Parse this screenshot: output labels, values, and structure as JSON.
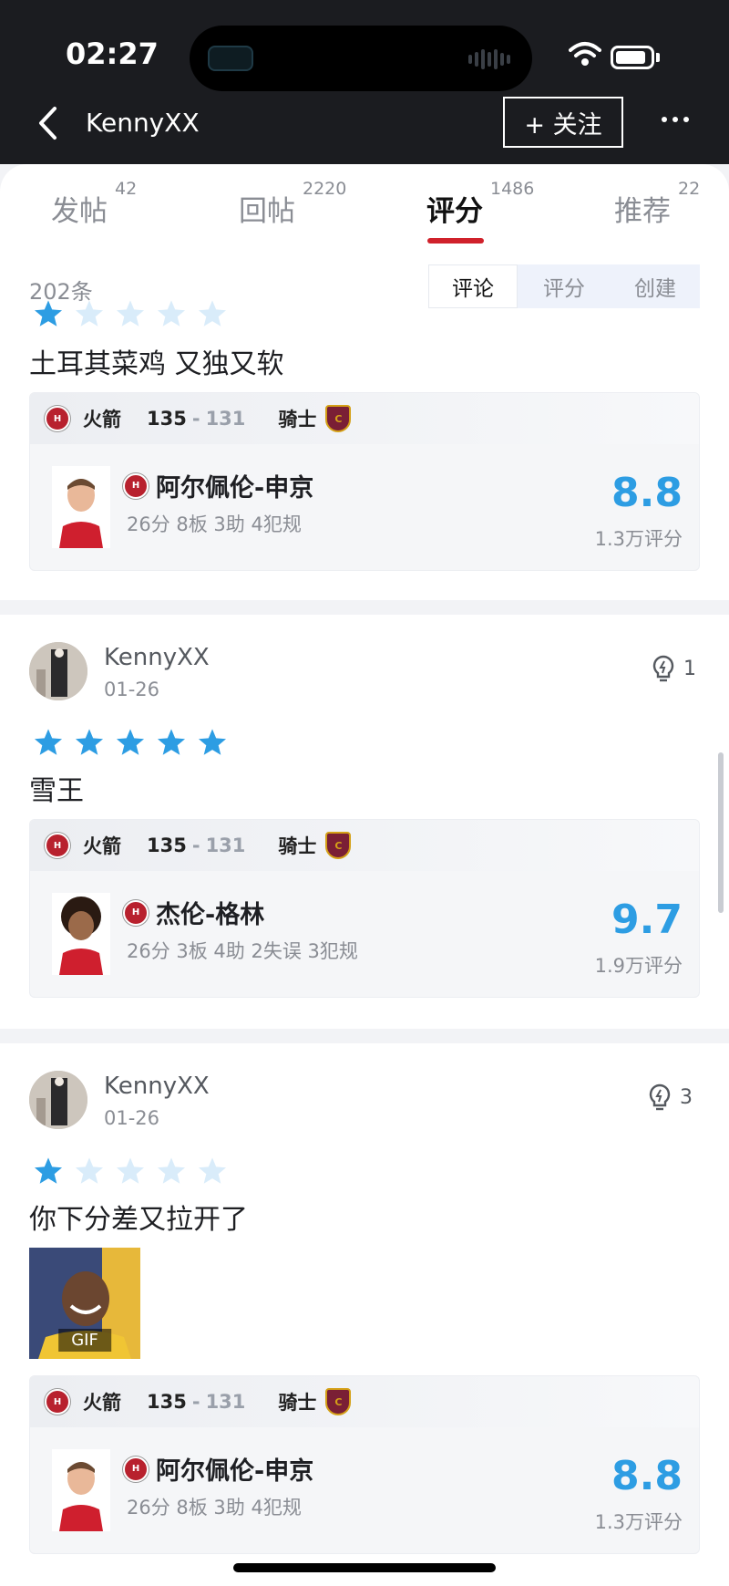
{
  "status": {
    "time": "02:27"
  },
  "nav": {
    "title": "KennyXX",
    "follow_label": "+ 关注"
  },
  "tabs": [
    {
      "label": "发帖",
      "count": "42",
      "active": false
    },
    {
      "label": "回帖",
      "count": "2220",
      "active": false
    },
    {
      "label": "评分",
      "count": "1486",
      "active": true
    },
    {
      "label": "推荐",
      "count": "22",
      "active": false
    }
  ],
  "filter": {
    "count_text": "202条",
    "segments": [
      "评论",
      "评分",
      "创建"
    ],
    "active_segment": "评论"
  },
  "game": {
    "home_team": "火箭",
    "home_score": "135",
    "sep": "-",
    "away_score": "131",
    "away_team": "骑士"
  },
  "posts": [
    {
      "stars": 1,
      "text": "土耳其菜鸡 又独又软",
      "player": {
        "name": "阿尔佩伦-申京",
        "stats": "26分 8板 3助 4犯规",
        "rating": "8.8",
        "rating_count": "1.3万评分"
      }
    },
    {
      "user": "KennyXX",
      "date": "01-26",
      "likes": "1",
      "stars": 5,
      "text": "雪王",
      "player": {
        "name": "杰伦-格林",
        "stats": "26分 3板 4助 2失误 3犯规",
        "rating": "9.7",
        "rating_count": "1.9万评分"
      }
    },
    {
      "user": "KennyXX",
      "date": "01-26",
      "likes": "3",
      "stars": 1,
      "text": "你下分差又拉开了",
      "gif_label": "GIF",
      "player": {
        "name": "阿尔佩伦-申京",
        "stats": "26分 8板 3助 4犯规",
        "rating": "8.8",
        "rating_count": "1.3万评分"
      }
    }
  ],
  "colors": {
    "accent": "#2d9de3",
    "tab_underline": "#d0212b",
    "star_on": "#2d9de3",
    "star_off": "#d9ecfa"
  },
  "icons": {
    "back": "chevron-left-icon",
    "more": "more-dots-icon",
    "like": "lightbulb-icon",
    "star": "star-icon"
  }
}
